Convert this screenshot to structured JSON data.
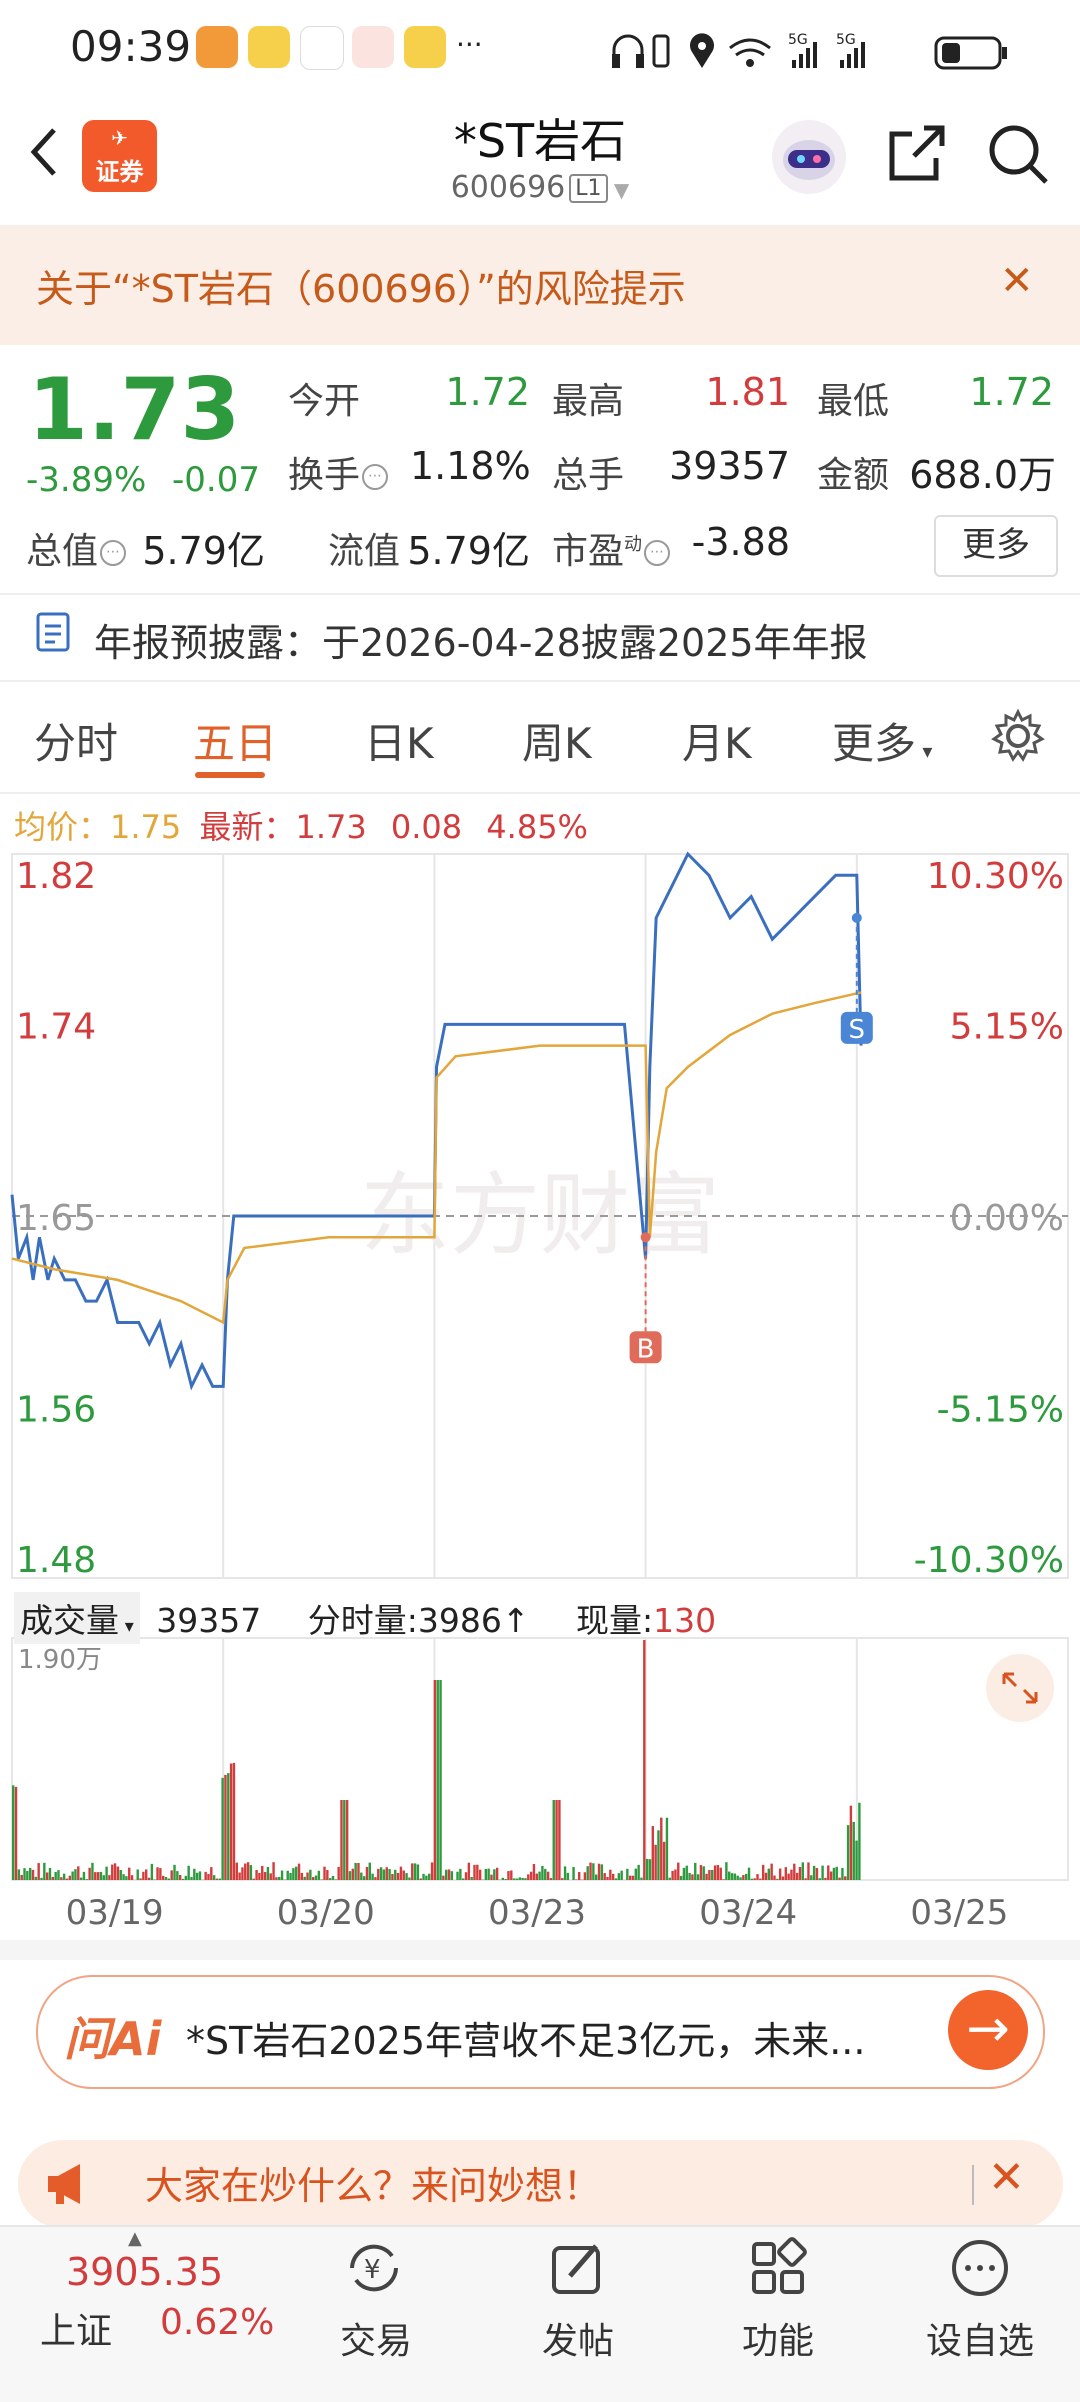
{
  "status": {
    "time": "09:39",
    "dots": "···"
  },
  "header": {
    "logo_text": "证券",
    "title": "*ST岩石",
    "code": "600696",
    "level": "L1"
  },
  "risk_banner": {
    "text": "关于“*ST岩石（600696）”的风险提示",
    "close": "✕"
  },
  "quote": {
    "price": "1.73",
    "change_pct": "-3.89%",
    "change_abs": "-0.07",
    "open_label": "今开",
    "open": "1.72",
    "high_label": "最高",
    "high": "1.81",
    "low_label": "最低",
    "low": "1.72",
    "turnover_label": "换手",
    "turnover": "1.18%",
    "volume_label": "总手",
    "volume": "39357",
    "amount_label": "金额",
    "amount": "688.0万",
    "mktcap_label": "总值",
    "mktcap": "5.79亿",
    "float_label": "流值",
    "float": "5.79亿",
    "pe_label": "市盈",
    "pe_sup": "动",
    "pe": "-3.88",
    "more": "更多"
  },
  "report_notice": "年报预披露：于2026-04-28披露2025年年报",
  "tabs": [
    "分时",
    "五日",
    "日K",
    "周K",
    "月K",
    "更多"
  ],
  "avg_row": {
    "avg_label": "均价：",
    "avg": "1.75",
    "latest_label": "最新：",
    "latest": "1.73",
    "chg": "0.08",
    "pct": "4.85%"
  },
  "chart_data": {
    "type": "line",
    "title": "",
    "watermark": "东方财富",
    "y_left_ticks": [
      "1.82",
      "1.74",
      "1.65",
      "1.56",
      "1.48"
    ],
    "y_right_ticks": [
      "10.30%",
      "5.15%",
      "0.00%",
      "-5.15%",
      "-10.30%"
    ],
    "ylim": [
      1.48,
      1.82
    ],
    "prev_close": 1.65,
    "x_days": [
      "03/19",
      "03/20",
      "03/23",
      "03/24",
      "03/25"
    ],
    "series": [
      {
        "name": "价格",
        "color": "#3a6fbf",
        "x": [
          0,
          0.03,
          0.07,
          0.1,
          0.13,
          0.17,
          0.2,
          0.25,
          0.3,
          0.35,
          0.4,
          0.45,
          0.5,
          0.55,
          0.6,
          0.65,
          0.7,
          0.75,
          0.8,
          0.85,
          0.9,
          0.95,
          1.0,
          1.02,
          1.05,
          1.1,
          1.5,
          1.6,
          2.0,
          2.01,
          2.05,
          2.5,
          2.9,
          3.0,
          3.02,
          3.05,
          3.1,
          3.2,
          3.3,
          3.4,
          3.5,
          3.6,
          3.7,
          3.8,
          3.9,
          4.0,
          4.02
        ],
        "values": [
          1.66,
          1.63,
          1.64,
          1.62,
          1.64,
          1.62,
          1.63,
          1.62,
          1.62,
          1.61,
          1.61,
          1.62,
          1.6,
          1.6,
          1.6,
          1.59,
          1.6,
          1.58,
          1.59,
          1.57,
          1.58,
          1.57,
          1.57,
          1.62,
          1.65,
          1.65,
          1.65,
          1.65,
          1.65,
          1.72,
          1.74,
          1.74,
          1.74,
          1.63,
          1.72,
          1.79,
          1.8,
          1.82,
          1.81,
          1.79,
          1.8,
          1.78,
          1.79,
          1.8,
          1.81,
          1.81,
          1.73
        ]
      },
      {
        "name": "均价",
        "color": "#e2a63a",
        "x": [
          0,
          0.2,
          0.5,
          0.8,
          1.0,
          1.02,
          1.1,
          1.5,
          2.0,
          2.01,
          2.1,
          2.5,
          3.0,
          3.02,
          3.05,
          3.1,
          3.2,
          3.4,
          3.6,
          3.8,
          4.02
        ],
        "values": [
          1.63,
          1.625,
          1.62,
          1.61,
          1.6,
          1.62,
          1.635,
          1.64,
          1.64,
          1.715,
          1.725,
          1.73,
          1.73,
          1.64,
          1.68,
          1.71,
          1.72,
          1.735,
          1.745,
          1.75,
          1.755
        ]
      }
    ],
    "markers": [
      {
        "label": "B",
        "x": 3.0,
        "value": 1.64
      },
      {
        "label": "S",
        "x": 4.0,
        "value": 1.79
      }
    ],
    "volume_header": {
      "label": "成交量",
      "total": "39357",
      "minute_label": "分时量:",
      "minute": "3986",
      "now_label": "现量:",
      "now": "130"
    },
    "volume_max_label": "1.90万"
  },
  "ai_bar": {
    "logo": "问Ai",
    "text": "*ST岩石2025年营收不足3亿元，未来...",
    "go": "→"
  },
  "promo": {
    "text": "大家在炒什么？来问妙想！",
    "close": "✕"
  },
  "bottom_nav": {
    "index_value": "3905.35",
    "index_name": "上证",
    "index_pct": "0.62%",
    "items": [
      "交易",
      "发帖",
      "功能",
      "设自选"
    ]
  },
  "colors": {
    "up": "#d23c3c",
    "down": "#2e9a3e",
    "accent": "#e0622a"
  }
}
